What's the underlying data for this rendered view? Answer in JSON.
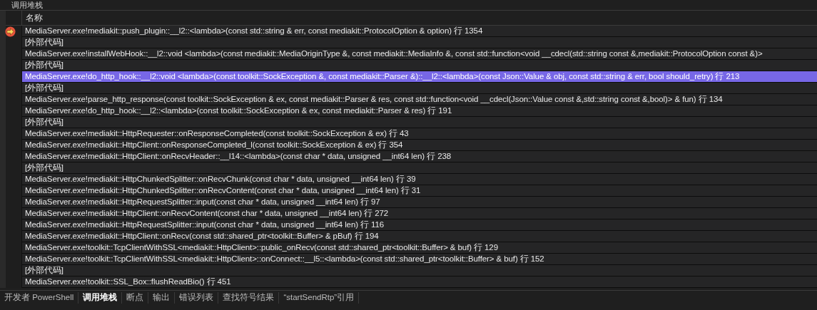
{
  "panel": {
    "title": "调用堆栈"
  },
  "table": {
    "columns": [
      "名称"
    ],
    "rows": [
      {
        "name": "MediaServer.exe!mediakit::push_plugin::__l2::<lambda>(const std::string & err, const mediakit::ProtocolOption & option) 行 1354",
        "current": true,
        "selected": false
      },
      {
        "name": "[外部代码]",
        "current": false,
        "selected": false
      },
      {
        "name": "MediaServer.exe!installWebHook::__l2::void <lambda>(const mediakit::MediaOriginType &, const mediakit::MediaInfo &, const std::function<void __cdecl(std::string const &,mediakit::ProtocolOption const &)>",
        "current": false,
        "selected": false
      },
      {
        "name": "[外部代码]",
        "current": false,
        "selected": false
      },
      {
        "name": "MediaServer.exe!do_http_hook::__l2::void <lambda>(const toolkit::SockException &, const mediakit::Parser &)::__l2::<lambda>(const Json::Value & obj, const std::string & err, bool should_retry) 行 213",
        "current": false,
        "selected": true
      },
      {
        "name": "[外部代码]",
        "current": false,
        "selected": false
      },
      {
        "name": "MediaServer.exe!parse_http_response(const toolkit::SockException & ex, const mediakit::Parser & res, const std::function<void __cdecl(Json::Value const &,std::string const &,bool)> & fun) 行 134",
        "current": false,
        "selected": false
      },
      {
        "name": "MediaServer.exe!do_http_hook::__l2::<lambda>(const toolkit::SockException & ex, const mediakit::Parser & res) 行 191",
        "current": false,
        "selected": false
      },
      {
        "name": "[外部代码]",
        "current": false,
        "selected": false
      },
      {
        "name": "MediaServer.exe!mediakit::HttpRequester::onResponseCompleted(const toolkit::SockException & ex) 行 43",
        "current": false,
        "selected": false
      },
      {
        "name": "MediaServer.exe!mediakit::HttpClient::onResponseCompleted_l(const toolkit::SockException & ex) 行 354",
        "current": false,
        "selected": false
      },
      {
        "name": "MediaServer.exe!mediakit::HttpClient::onRecvHeader::__l14::<lambda>(const char * data, unsigned __int64 len) 行 238",
        "current": false,
        "selected": false
      },
      {
        "name": "[外部代码]",
        "current": false,
        "selected": false
      },
      {
        "name": "MediaServer.exe!mediakit::HttpChunkedSplitter::onRecvChunk(const char * data, unsigned __int64 len) 行 39",
        "current": false,
        "selected": false
      },
      {
        "name": "MediaServer.exe!mediakit::HttpChunkedSplitter::onRecvContent(const char * data, unsigned __int64 len) 行 31",
        "current": false,
        "selected": false
      },
      {
        "name": "MediaServer.exe!mediakit::HttpRequestSplitter::input(const char * data, unsigned __int64 len) 行 97",
        "current": false,
        "selected": false
      },
      {
        "name": "MediaServer.exe!mediakit::HttpClient::onRecvContent(const char * data, unsigned __int64 len) 行 272",
        "current": false,
        "selected": false
      },
      {
        "name": "MediaServer.exe!mediakit::HttpRequestSplitter::input(const char * data, unsigned __int64 len) 行 116",
        "current": false,
        "selected": false
      },
      {
        "name": "MediaServer.exe!mediakit::HttpClient::onRecv(const std::shared_ptr<toolkit::Buffer> & pBuf) 行 194",
        "current": false,
        "selected": false
      },
      {
        "name": "MediaServer.exe!toolkit::TcpClientWithSSL<mediakit::HttpClient>::public_onRecv(const std::shared_ptr<toolkit::Buffer> & buf) 行 129",
        "current": false,
        "selected": false
      },
      {
        "name": "MediaServer.exe!toolkit::TcpClientWithSSL<mediakit::HttpClient>::onConnect::__l5::<lambda>(const std::shared_ptr<toolkit::Buffer> & buf) 行 152",
        "current": false,
        "selected": false
      },
      {
        "name": "[外部代码]",
        "current": false,
        "selected": false
      },
      {
        "name": "MediaServer.exe!toolkit::SSL_Box::flushReadBio() 行 451",
        "current": false,
        "selected": false
      }
    ]
  },
  "tabs": [
    {
      "label": "开发者 PowerShell",
      "selected": false
    },
    {
      "label": "调用堆栈",
      "selected": true
    },
    {
      "label": "断点",
      "selected": false
    },
    {
      "label": "输出",
      "selected": false
    },
    {
      "label": "错误列表",
      "selected": false
    },
    {
      "label": "查找符号结果",
      "selected": false
    },
    {
      "label": "“startSendRtp”引用",
      "selected": false
    }
  ]
}
